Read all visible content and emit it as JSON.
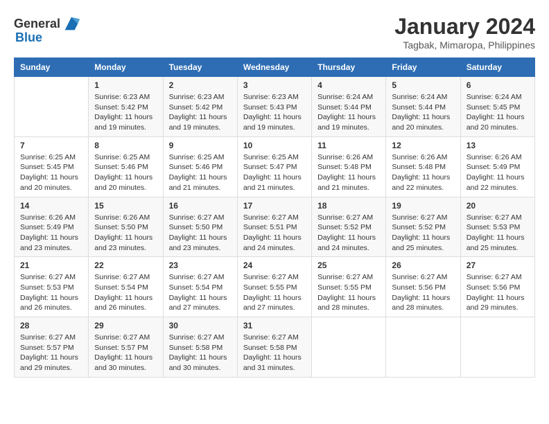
{
  "logo": {
    "text_general": "General",
    "text_blue": "Blue"
  },
  "title": "January 2024",
  "subtitle": "Tagbak, Mimaropa, Philippines",
  "days_of_week": [
    "Sunday",
    "Monday",
    "Tuesday",
    "Wednesday",
    "Thursday",
    "Friday",
    "Saturday"
  ],
  "weeks": [
    [
      {
        "day": "",
        "info": ""
      },
      {
        "day": "1",
        "info": "Sunrise: 6:23 AM\nSunset: 5:42 PM\nDaylight: 11 hours\nand 19 minutes."
      },
      {
        "day": "2",
        "info": "Sunrise: 6:23 AM\nSunset: 5:42 PM\nDaylight: 11 hours\nand 19 minutes."
      },
      {
        "day": "3",
        "info": "Sunrise: 6:23 AM\nSunset: 5:43 PM\nDaylight: 11 hours\nand 19 minutes."
      },
      {
        "day": "4",
        "info": "Sunrise: 6:24 AM\nSunset: 5:44 PM\nDaylight: 11 hours\nand 19 minutes."
      },
      {
        "day": "5",
        "info": "Sunrise: 6:24 AM\nSunset: 5:44 PM\nDaylight: 11 hours\nand 20 minutes."
      },
      {
        "day": "6",
        "info": "Sunrise: 6:24 AM\nSunset: 5:45 PM\nDaylight: 11 hours\nand 20 minutes."
      }
    ],
    [
      {
        "day": "7",
        "info": "Sunrise: 6:25 AM\nSunset: 5:45 PM\nDaylight: 11 hours\nand 20 minutes."
      },
      {
        "day": "8",
        "info": "Sunrise: 6:25 AM\nSunset: 5:46 PM\nDaylight: 11 hours\nand 20 minutes."
      },
      {
        "day": "9",
        "info": "Sunrise: 6:25 AM\nSunset: 5:46 PM\nDaylight: 11 hours\nand 21 minutes."
      },
      {
        "day": "10",
        "info": "Sunrise: 6:25 AM\nSunset: 5:47 PM\nDaylight: 11 hours\nand 21 minutes."
      },
      {
        "day": "11",
        "info": "Sunrise: 6:26 AM\nSunset: 5:48 PM\nDaylight: 11 hours\nand 21 minutes."
      },
      {
        "day": "12",
        "info": "Sunrise: 6:26 AM\nSunset: 5:48 PM\nDaylight: 11 hours\nand 22 minutes."
      },
      {
        "day": "13",
        "info": "Sunrise: 6:26 AM\nSunset: 5:49 PM\nDaylight: 11 hours\nand 22 minutes."
      }
    ],
    [
      {
        "day": "14",
        "info": "Sunrise: 6:26 AM\nSunset: 5:49 PM\nDaylight: 11 hours\nand 23 minutes."
      },
      {
        "day": "15",
        "info": "Sunrise: 6:26 AM\nSunset: 5:50 PM\nDaylight: 11 hours\nand 23 minutes."
      },
      {
        "day": "16",
        "info": "Sunrise: 6:27 AM\nSunset: 5:50 PM\nDaylight: 11 hours\nand 23 minutes."
      },
      {
        "day": "17",
        "info": "Sunrise: 6:27 AM\nSunset: 5:51 PM\nDaylight: 11 hours\nand 24 minutes."
      },
      {
        "day": "18",
        "info": "Sunrise: 6:27 AM\nSunset: 5:52 PM\nDaylight: 11 hours\nand 24 minutes."
      },
      {
        "day": "19",
        "info": "Sunrise: 6:27 AM\nSunset: 5:52 PM\nDaylight: 11 hours\nand 25 minutes."
      },
      {
        "day": "20",
        "info": "Sunrise: 6:27 AM\nSunset: 5:53 PM\nDaylight: 11 hours\nand 25 minutes."
      }
    ],
    [
      {
        "day": "21",
        "info": "Sunrise: 6:27 AM\nSunset: 5:53 PM\nDaylight: 11 hours\nand 26 minutes."
      },
      {
        "day": "22",
        "info": "Sunrise: 6:27 AM\nSunset: 5:54 PM\nDaylight: 11 hours\nand 26 minutes."
      },
      {
        "day": "23",
        "info": "Sunrise: 6:27 AM\nSunset: 5:54 PM\nDaylight: 11 hours\nand 27 minutes."
      },
      {
        "day": "24",
        "info": "Sunrise: 6:27 AM\nSunset: 5:55 PM\nDaylight: 11 hours\nand 27 minutes."
      },
      {
        "day": "25",
        "info": "Sunrise: 6:27 AM\nSunset: 5:55 PM\nDaylight: 11 hours\nand 28 minutes."
      },
      {
        "day": "26",
        "info": "Sunrise: 6:27 AM\nSunset: 5:56 PM\nDaylight: 11 hours\nand 28 minutes."
      },
      {
        "day": "27",
        "info": "Sunrise: 6:27 AM\nSunset: 5:56 PM\nDaylight: 11 hours\nand 29 minutes."
      }
    ],
    [
      {
        "day": "28",
        "info": "Sunrise: 6:27 AM\nSunset: 5:57 PM\nDaylight: 11 hours\nand 29 minutes."
      },
      {
        "day": "29",
        "info": "Sunrise: 6:27 AM\nSunset: 5:57 PM\nDaylight: 11 hours\nand 30 minutes."
      },
      {
        "day": "30",
        "info": "Sunrise: 6:27 AM\nSunset: 5:58 PM\nDaylight: 11 hours\nand 30 minutes."
      },
      {
        "day": "31",
        "info": "Sunrise: 6:27 AM\nSunset: 5:58 PM\nDaylight: 11 hours\nand 31 minutes."
      },
      {
        "day": "",
        "info": ""
      },
      {
        "day": "",
        "info": ""
      },
      {
        "day": "",
        "info": ""
      }
    ]
  ]
}
